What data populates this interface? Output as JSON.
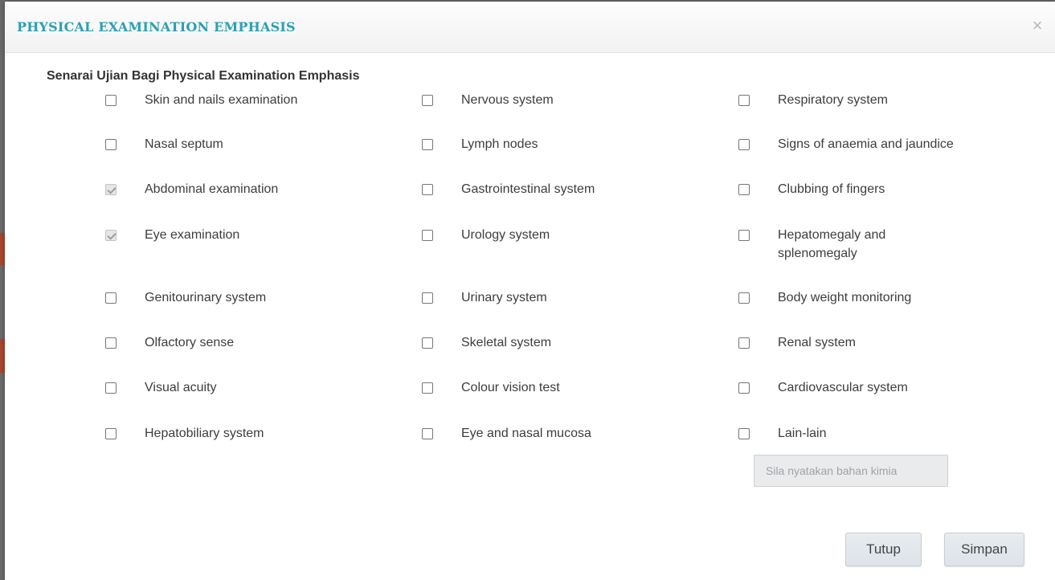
{
  "modal": {
    "title": "PHYSICAL EXAMINATION EMPHASIS",
    "close_symbol": "×"
  },
  "section": {
    "title": "Senarai Ujian Bagi Physical Examination Emphasis"
  },
  "columns": [
    [
      {
        "label": "Skin and nails examination",
        "checked": false
      },
      {
        "label": "Nasal septum",
        "checked": false
      },
      {
        "label": "Abdominal examination",
        "checked": true
      },
      {
        "label": "Eye examination",
        "checked": true
      },
      {
        "label": "Genitourinary system",
        "checked": false
      },
      {
        "label": "Olfactory sense",
        "checked": false
      },
      {
        "label": "Visual acuity",
        "checked": false
      },
      {
        "label": "Hepatobiliary system",
        "checked": false
      }
    ],
    [
      {
        "label": "Nervous system",
        "checked": false
      },
      {
        "label": "Lymph nodes",
        "checked": false
      },
      {
        "label": "Gastrointestinal system",
        "checked": false
      },
      {
        "label": "Urology system",
        "checked": false
      },
      {
        "label": "Urinary system",
        "checked": false
      },
      {
        "label": "Skeletal system",
        "checked": false
      },
      {
        "label": "Colour vision test",
        "checked": false
      },
      {
        "label": "Eye and nasal mucosa",
        "checked": false
      }
    ],
    [
      {
        "label": "Respiratory system",
        "checked": false
      },
      {
        "label": "Signs of anaemia and jaundice",
        "checked": false
      },
      {
        "label": "Clubbing of fingers",
        "checked": false
      },
      {
        "label": "Hepatomegaly and splenomegaly",
        "checked": false
      },
      {
        "label": "Body weight monitoring",
        "checked": false
      },
      {
        "label": "Renal system",
        "checked": false
      },
      {
        "label": "Cardiovascular system",
        "checked": false
      },
      {
        "label": "Lain-lain",
        "checked": false
      }
    ]
  ],
  "other_input": {
    "placeholder": "Sila nyatakan bahan kimia",
    "value": ""
  },
  "buttons": {
    "close_label": "Tutup",
    "save_label": "Simpan"
  },
  "colors": {
    "title": "#2a9fb3",
    "checked_box": "#e6e6e6",
    "button_bg": "#dde3e8"
  }
}
